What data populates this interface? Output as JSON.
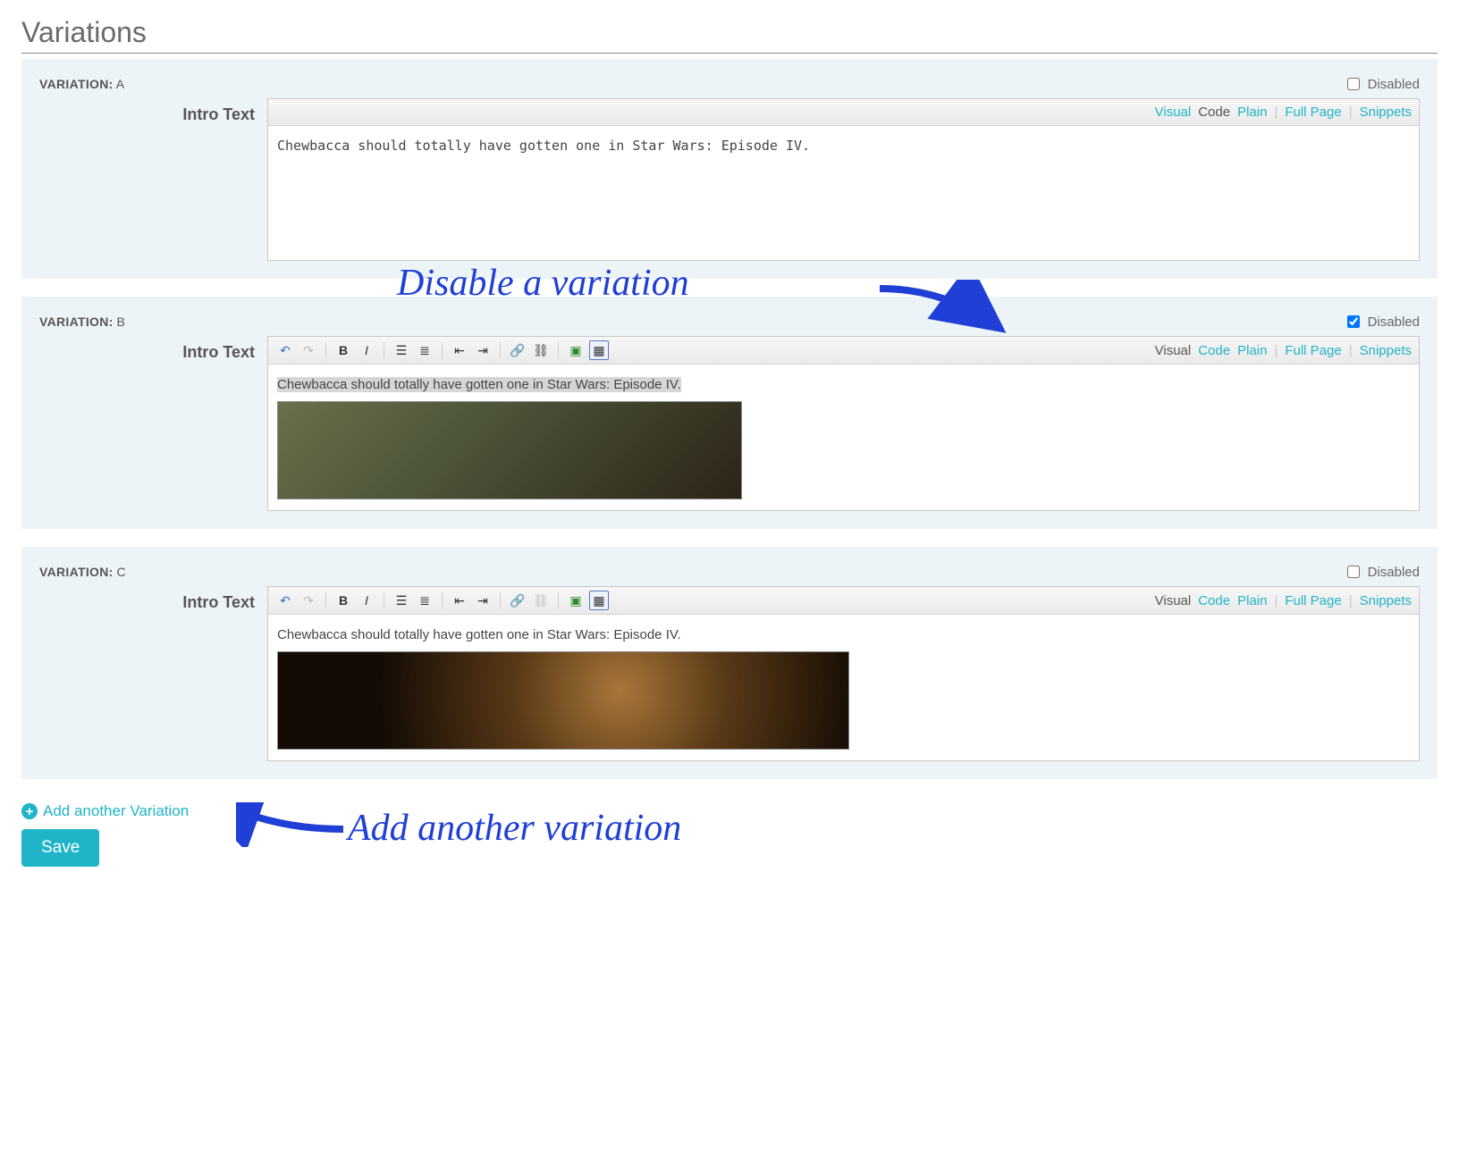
{
  "page": {
    "title": "Variations"
  },
  "common": {
    "variation_word": "VARIATION:",
    "disabled_label": "Disabled",
    "field_label": "Intro Text",
    "tabs": {
      "visual": "Visual",
      "code": "Code",
      "plain": "Plain",
      "full_page": "Full Page",
      "snippets": "Snippets"
    }
  },
  "variations": [
    {
      "id": "A",
      "disabled_checked": false,
      "editor_mode": "code",
      "active_tab": "code",
      "content_text": "Chewbacca should totally have gotten one in Star Wars: Episode IV.",
      "has_image": false
    },
    {
      "id": "B",
      "disabled_checked": true,
      "editor_mode": "visual",
      "active_tab": "visual",
      "content_text": "Chewbacca should totally have gotten one in Star Wars: Episode IV.",
      "has_image": true,
      "image_style": "group"
    },
    {
      "id": "C",
      "disabled_checked": false,
      "editor_mode": "visual",
      "active_tab": "visual",
      "content_text": "Chewbacca should totally have gotten one in Star Wars: Episode IV.",
      "has_image": true,
      "image_style": "dark"
    }
  ],
  "footer": {
    "add_link": "Add another Variation",
    "save": "Save"
  },
  "annotations": {
    "disable": "Disable a variation",
    "add": "Add another variation"
  }
}
